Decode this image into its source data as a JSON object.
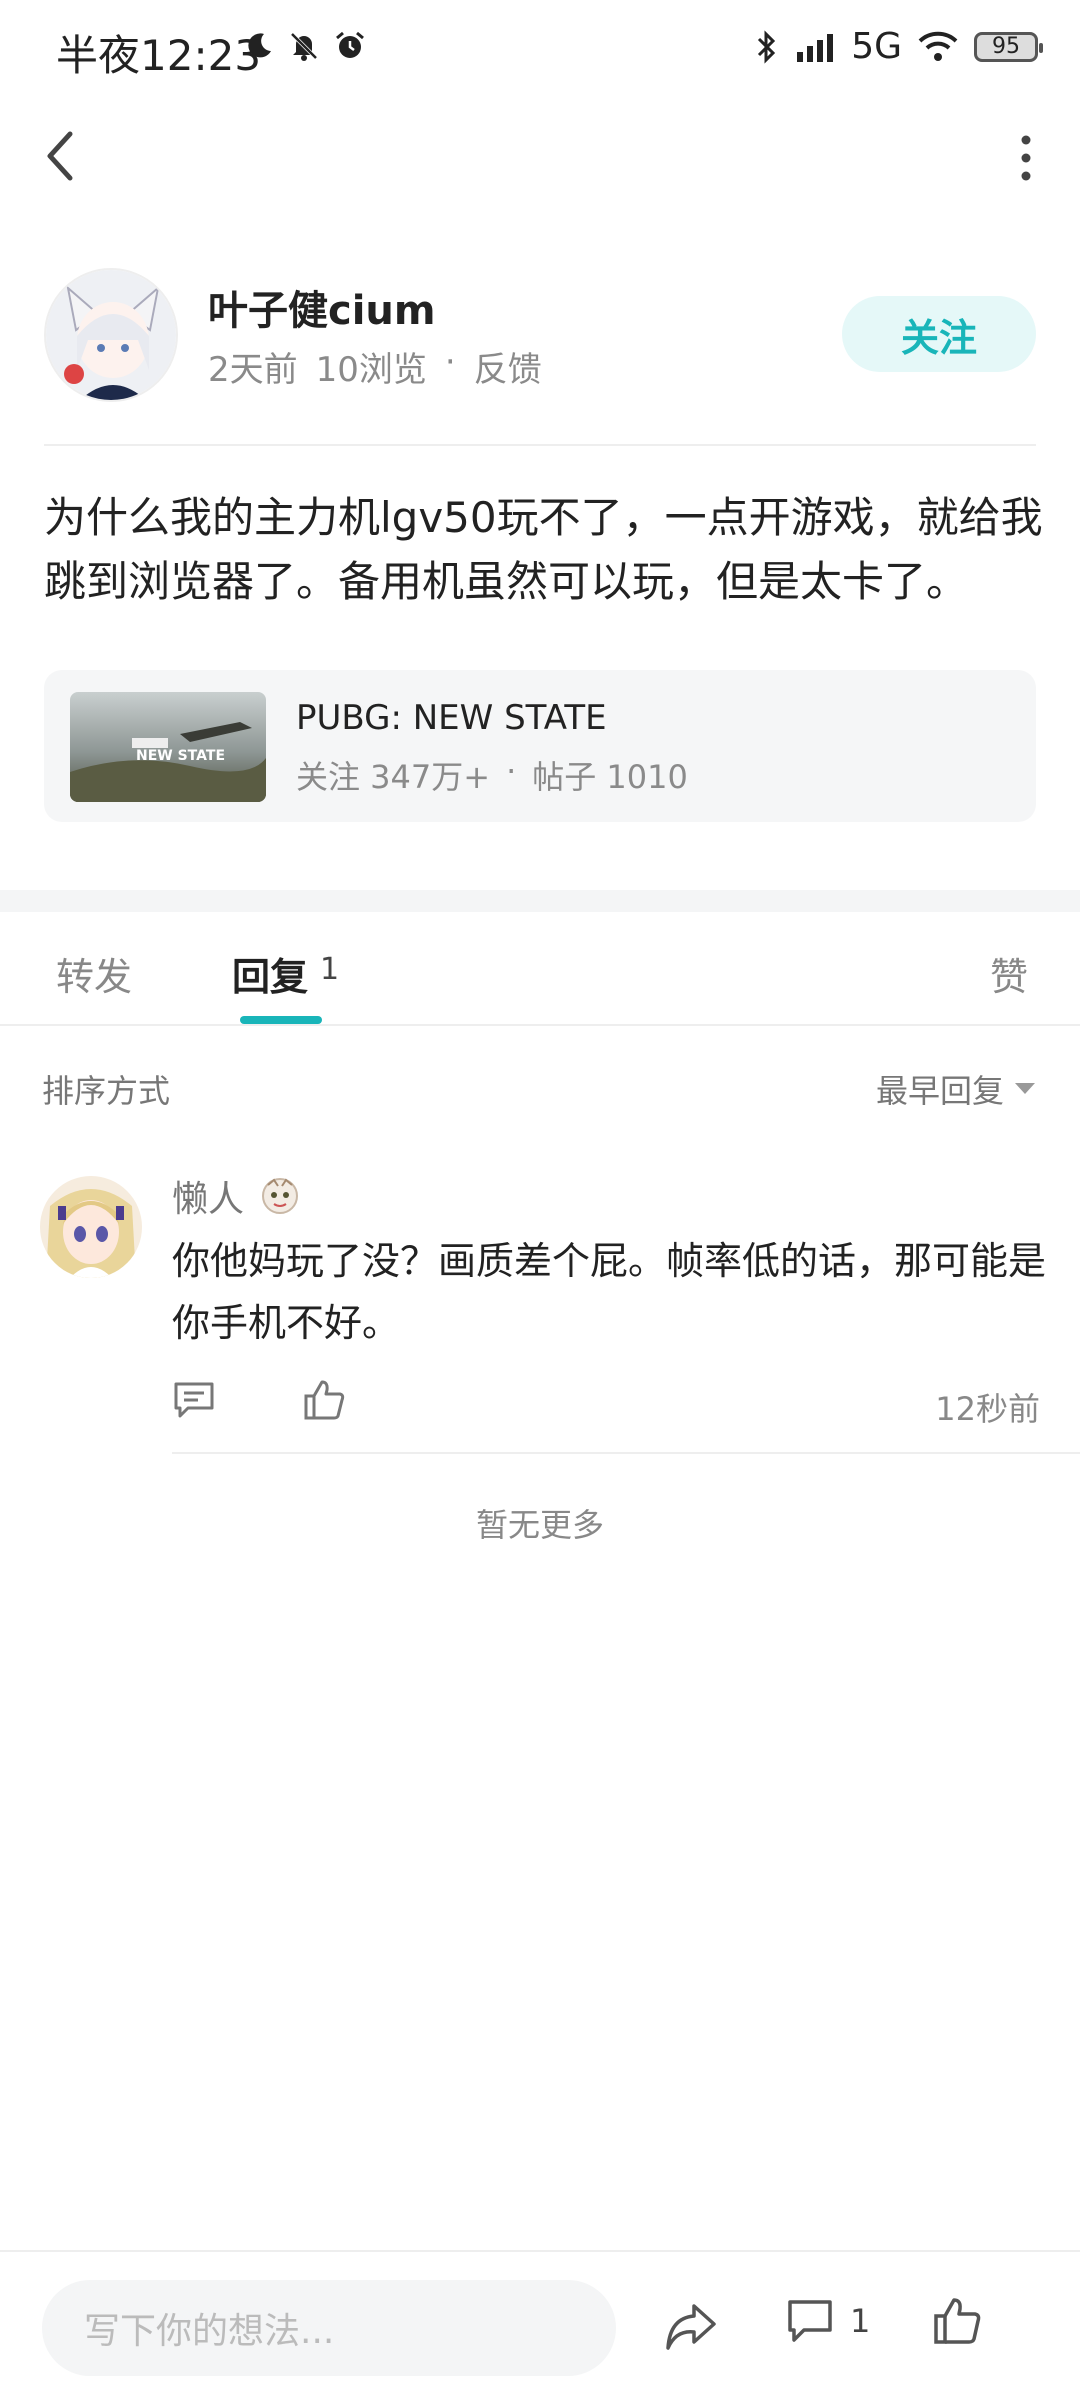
{
  "status_bar": {
    "time": "半夜12:23",
    "network": "5G",
    "battery": "95",
    "icons": [
      "moon-icon",
      "bell-off-icon",
      "alarm-icon",
      "bluetooth-icon",
      "signal-icon",
      "wifi-icon",
      "battery-icon"
    ]
  },
  "post": {
    "author": "叶子健cium",
    "time_ago": "2天前",
    "views": "10浏览",
    "separator": "·",
    "feedback": "反馈",
    "follow_label": "关注",
    "body": "为什么我的主力机lgv50玩不了，一点开游戏，就给我跳到浏览器了。备用机虽然可以玩，但是太卡了。"
  },
  "game_card": {
    "name": "PUBG: NEW STATE",
    "followers": "关注 347万+",
    "separator": "·",
    "posts": "帖子 1010",
    "thumb_text": "NEW STATE"
  },
  "tabs": {
    "forward": "转发",
    "reply": "回复",
    "reply_count": "1",
    "like": "赞"
  },
  "sort": {
    "label": "排序方式",
    "selected": "最早回复"
  },
  "comment": {
    "author": "懒人",
    "text": "你他妈玩了没？画质差个屁。帧率低的话，那可能是你手机不好。",
    "time": "12秒前"
  },
  "no_more": "暂无更多",
  "bottom_bar": {
    "input_placeholder": "写下你的想法...",
    "comment_count": "1"
  },
  "colors": {
    "accent": "#19b5b9",
    "follow_bg": "#e5f8f8"
  }
}
